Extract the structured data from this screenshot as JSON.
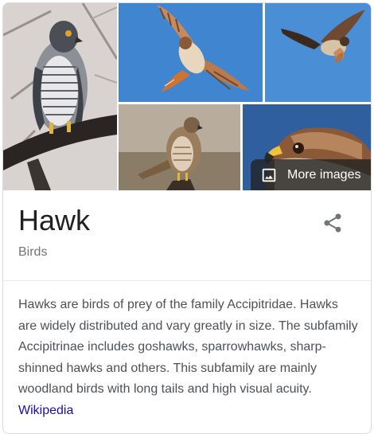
{
  "knowledge_panel": {
    "title": "Hawk",
    "subtitle": "Birds",
    "description": "Hawks are birds of prey of the family Accipitridae. Hawks are widely distributed and vary greatly in size. The subfamily Accipitrinae includes goshawks, sparrowhawks, sharp-shinned hawks and others. This subfamily are mainly woodland birds with long tails and high visual acuity.",
    "source_link": "Wikipedia",
    "more_images_label": "More images",
    "icons": {
      "share": "share-icon",
      "image": "image-icon"
    },
    "colors": {
      "link": "#1a0dab",
      "title": "#202124",
      "subtitle": "#70757a",
      "body": "#4d5156",
      "sky": "#3d7fc7"
    }
  }
}
